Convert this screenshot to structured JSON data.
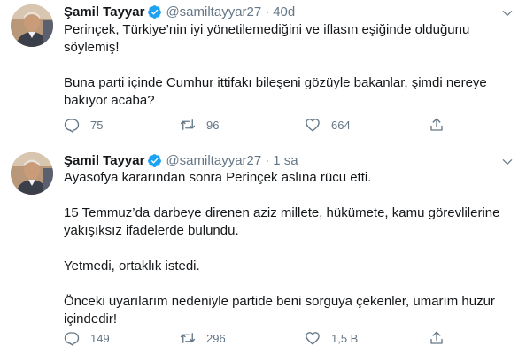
{
  "tweets": [
    {
      "name": "Şamil Tayyar",
      "handle": "@samiltayyar27",
      "separator": "·",
      "time": "40d",
      "paragraphs": [
        "Perinçek, Türkiye’nin iyi yönetilemediğini ve iflasın eşiğinde olduğunu söylemiş!",
        "Buna parti içinde Cumhur ittifakı bileşeni gözüyle bakanlar, şimdi nereye bakıyor acaba?"
      ],
      "replies": "75",
      "retweets": "96",
      "likes": "664"
    },
    {
      "name": "Şamil Tayyar",
      "handle": "@samiltayyar27",
      "separator": "·",
      "time": "1 sa",
      "paragraphs": [
        "Ayasofya kararından sonra Perinçek aslına rücu etti.",
        "15 Temmuz’da darbeye direnen aziz millete, hükümete, kamu görevlilerine yakışıksız ifadelerde bulundu.",
        "Yetmedi, ortaklık istedi.",
        "Önceki uyarılarım nedeniyle partide beni sorguya çekenler, umarım huzur içindedir!"
      ],
      "replies": "149",
      "retweets": "296",
      "likes": "1,5 B"
    }
  ],
  "colors": {
    "text": "#14171a",
    "secondary": "#657786",
    "verified": "#1da1f2",
    "divider": "#e6ecf0"
  },
  "icons": [
    "verified-badge-icon",
    "chevron-down-icon",
    "reply-icon",
    "retweet-icon",
    "like-icon",
    "share-icon"
  ]
}
